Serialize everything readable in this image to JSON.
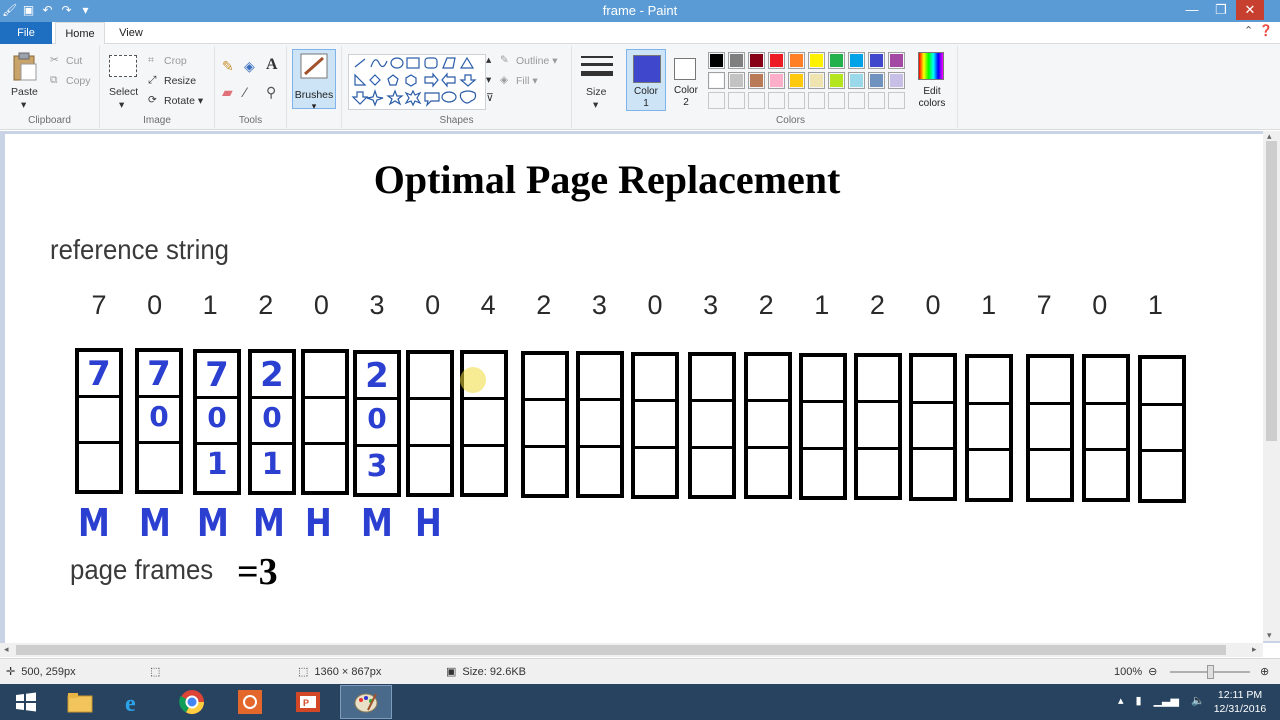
{
  "window": {
    "title": "frame - Paint"
  },
  "tabs": [
    {
      "label": "File"
    },
    {
      "label": "Home"
    },
    {
      "label": "View"
    }
  ],
  "ribbon": {
    "clipboard": {
      "label": "Clipboard",
      "paste": "Paste",
      "cut": "Cut",
      "copy": "Copy"
    },
    "image": {
      "label": "Image",
      "select": "Select",
      "crop": "Crop",
      "resize": "Resize",
      "rotate": "Rotate"
    },
    "tools": {
      "label": "Tools"
    },
    "brushes": {
      "label": "Brushes"
    },
    "shapes": {
      "label": "Shapes",
      "outline": "Outline",
      "fill": "Fill"
    },
    "size": {
      "label": "Size"
    },
    "colors": {
      "label": "Colors",
      "color1": "Color\n1",
      "color2": "Color\n2",
      "edit": "Edit colors",
      "color1_value": "#3f48cc",
      "color2_value": "#ffffff",
      "palette_row1": [
        "#000000",
        "#7f7f7f",
        "#880015",
        "#ed1c24",
        "#ff7f27",
        "#fff200",
        "#22b14c",
        "#00a2e8",
        "#3f48cc",
        "#a349a4"
      ],
      "palette_row2": [
        "#ffffff",
        "#c3c3c3",
        "#b97a57",
        "#ffaec9",
        "#ffc90e",
        "#efe4b0",
        "#b5e61d",
        "#99d9ea",
        "#7092be",
        "#c8bfe7"
      ]
    }
  },
  "canvas": {
    "title": "Optimal Page Replacement",
    "reference_label": "reference string",
    "reference_string": [
      "7",
      "0",
      "1",
      "2",
      "0",
      "3",
      "0",
      "4",
      "2",
      "3",
      "0",
      "3",
      "2",
      "1",
      "2",
      "0",
      "1",
      "7",
      "0",
      "1"
    ],
    "frames": [
      [
        "7",
        "",
        ""
      ],
      [
        "7",
        "0",
        ""
      ],
      [
        "7",
        "0",
        "1"
      ],
      [
        "2",
        "0",
        "1"
      ],
      [
        "",
        "",
        ""
      ],
      [
        "2",
        "0",
        "3"
      ],
      [
        "",
        "",
        ""
      ],
      [
        "",
        "",
        ""
      ],
      [
        "",
        "",
        ""
      ],
      [
        "",
        "",
        ""
      ],
      [
        "",
        "",
        ""
      ],
      [
        "",
        "",
        ""
      ],
      [
        "",
        "",
        ""
      ],
      [
        "",
        "",
        ""
      ],
      [
        "",
        "",
        ""
      ],
      [
        "",
        "",
        ""
      ],
      [
        "",
        "",
        ""
      ],
      [
        "",
        "",
        ""
      ],
      [
        "",
        "",
        ""
      ],
      [
        "",
        "",
        ""
      ]
    ],
    "hit_miss": [
      "M",
      "M",
      "M",
      "M",
      "H",
      "M",
      "H"
    ],
    "page_frames_label": "page frames",
    "page_frames_value": "=3"
  },
  "status": {
    "cursor_pos": "500, 259px",
    "image_size": "1360 × 867px",
    "file_size": "Size: 92.6KB",
    "zoom": "100%"
  },
  "taskbar": {
    "time": "12:11 PM",
    "date": "12/31/2016"
  }
}
